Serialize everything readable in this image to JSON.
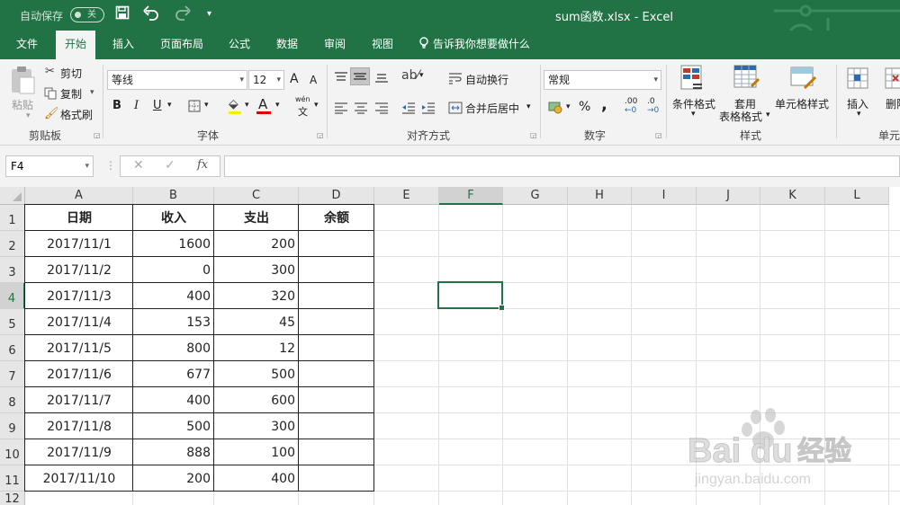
{
  "titlebar": {
    "autosave_label": "自动保存",
    "autosave_state": "关",
    "window_title": "sum函数.xlsx  -  Excel"
  },
  "tabs": [
    {
      "label": "文件"
    },
    {
      "label": "开始"
    },
    {
      "label": "插入"
    },
    {
      "label": "页面布局"
    },
    {
      "label": "公式"
    },
    {
      "label": "数据"
    },
    {
      "label": "审阅"
    },
    {
      "label": "视图"
    }
  ],
  "tell_me": "告诉我你想要做什么",
  "ribbon": {
    "clipboard": {
      "paste": "粘贴",
      "cut": "剪切",
      "copy": "复制",
      "format_painter": "格式刷",
      "label": "剪贴板"
    },
    "font": {
      "name": "等线",
      "size": "12",
      "bold": "B",
      "italic": "I",
      "underline": "U",
      "grow": "A",
      "shrink": "A",
      "label": "字体",
      "wen": "wén",
      "wen_char": "文"
    },
    "alignment": {
      "wrap": "自动换行",
      "merge": "合并后居中",
      "label": "对齐方式"
    },
    "number": {
      "format": "常规",
      "percent": "%",
      "comma": ",",
      "inc_decimal": ".00",
      "dec_decimal": ".0",
      "label": "数字"
    },
    "styles": {
      "conditional": "条件格式",
      "table_format_1": "套用",
      "table_format_2": "表格格式",
      "cell_styles": "单元格样式",
      "label": "样式"
    },
    "cells": {
      "insert": "插入",
      "delete": "删除",
      "label": "单元"
    }
  },
  "formula": {
    "namebox": "F4",
    "fx": "fx",
    "value": ""
  },
  "columns": [
    "A",
    "B",
    "C",
    "D",
    "E",
    "F",
    "G",
    "H",
    "I",
    "J",
    "K",
    "L"
  ],
  "rows": [
    "1",
    "2",
    "3",
    "4",
    "5",
    "6",
    "7",
    "8",
    "9",
    "10",
    "11",
    "12"
  ],
  "table": {
    "headers": [
      "日期",
      "收入",
      "支出",
      "余额"
    ],
    "rows": [
      [
        "2017/11/1",
        "1600",
        "200",
        ""
      ],
      [
        "2017/11/2",
        "0",
        "300",
        ""
      ],
      [
        "2017/11/3",
        "400",
        "320",
        ""
      ],
      [
        "2017/11/4",
        "153",
        "45",
        ""
      ],
      [
        "2017/11/5",
        "800",
        "12",
        ""
      ],
      [
        "2017/11/6",
        "677",
        "500",
        ""
      ],
      [
        "2017/11/7",
        "400",
        "600",
        ""
      ],
      [
        "2017/11/8",
        "500",
        "300",
        ""
      ],
      [
        "2017/11/9",
        "888",
        "100",
        ""
      ],
      [
        "2017/11/10",
        "200",
        "400",
        ""
      ]
    ]
  },
  "watermark": {
    "brand": "Bai",
    "brand2": "du",
    "cn": "经验",
    "url": "jingyan.baidu.com"
  },
  "colors": {
    "accent": "#217346",
    "ribbon": "#f3f3f3",
    "header": "#e6e6e6"
  }
}
